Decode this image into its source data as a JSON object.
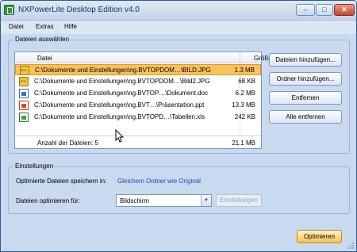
{
  "window": {
    "title": "NXPowerLite Desktop Edition v4.0"
  },
  "menu": [
    {
      "label": "Datei"
    },
    {
      "label": "Extras"
    },
    {
      "label": "Hilfe"
    }
  ],
  "files_group": {
    "title": "Dateien auswählen",
    "columns": {
      "file": "Datei",
      "size": "Größe"
    },
    "rows": [
      {
        "icon": "jpg-file-icon",
        "path": "C:\\Dokumente und Einstellungen\\ng.BVTOPDOM…\\BILD.JPG",
        "size": "1.3 MB",
        "selected": true
      },
      {
        "icon": "jpg-file-icon",
        "path": "C:\\Dokumente und Einstellungen\\ng.BVTOPDOM…\\Bild2.JPG",
        "size": "68 KB",
        "selected": false
      },
      {
        "icon": "word-doc-icon",
        "path": "C:\\Dokumente und Einstellungen\\ng.BVTOP…\\Dokument.doc",
        "size": "6.2 MB",
        "selected": false
      },
      {
        "icon": "powerpoint-file-icon",
        "path": "C:\\Dokumente und Einstellungen\\ng.BVT…\\Präsentation.ppt",
        "size": "13.3 MB",
        "selected": false
      },
      {
        "icon": "excel-file-icon",
        "path": "C:\\Dokumente und Einstellungen\\ng.BVTOPD…\\Tabellen.xls",
        "size": "242 KB",
        "selected": false
      }
    ],
    "footer": {
      "count_label": "Anzahl der Dateien: 5",
      "total_size": "21.1 MB"
    },
    "buttons": {
      "add_files": "Dateien hinzufügen...",
      "add_folder": "Ordner hinzufügen...",
      "remove": "Entfernen",
      "remove_all": "Alle entfernen"
    }
  },
  "settings_group": {
    "title": "Einstellungen",
    "save_label": "Optimierte Dateien speichern in:",
    "save_link": "Gleichem Ordner wie Original",
    "optimize_for_label": "Dateien optimieren für:",
    "optimize_for_value": "Bildschirm",
    "settings_button": "Einstellungen"
  },
  "optimize_button": "Optimieren",
  "colors": {
    "selected_row": "#fbc15a",
    "link": "#1a4fb8",
    "window_bg": "#c9d9ee"
  }
}
